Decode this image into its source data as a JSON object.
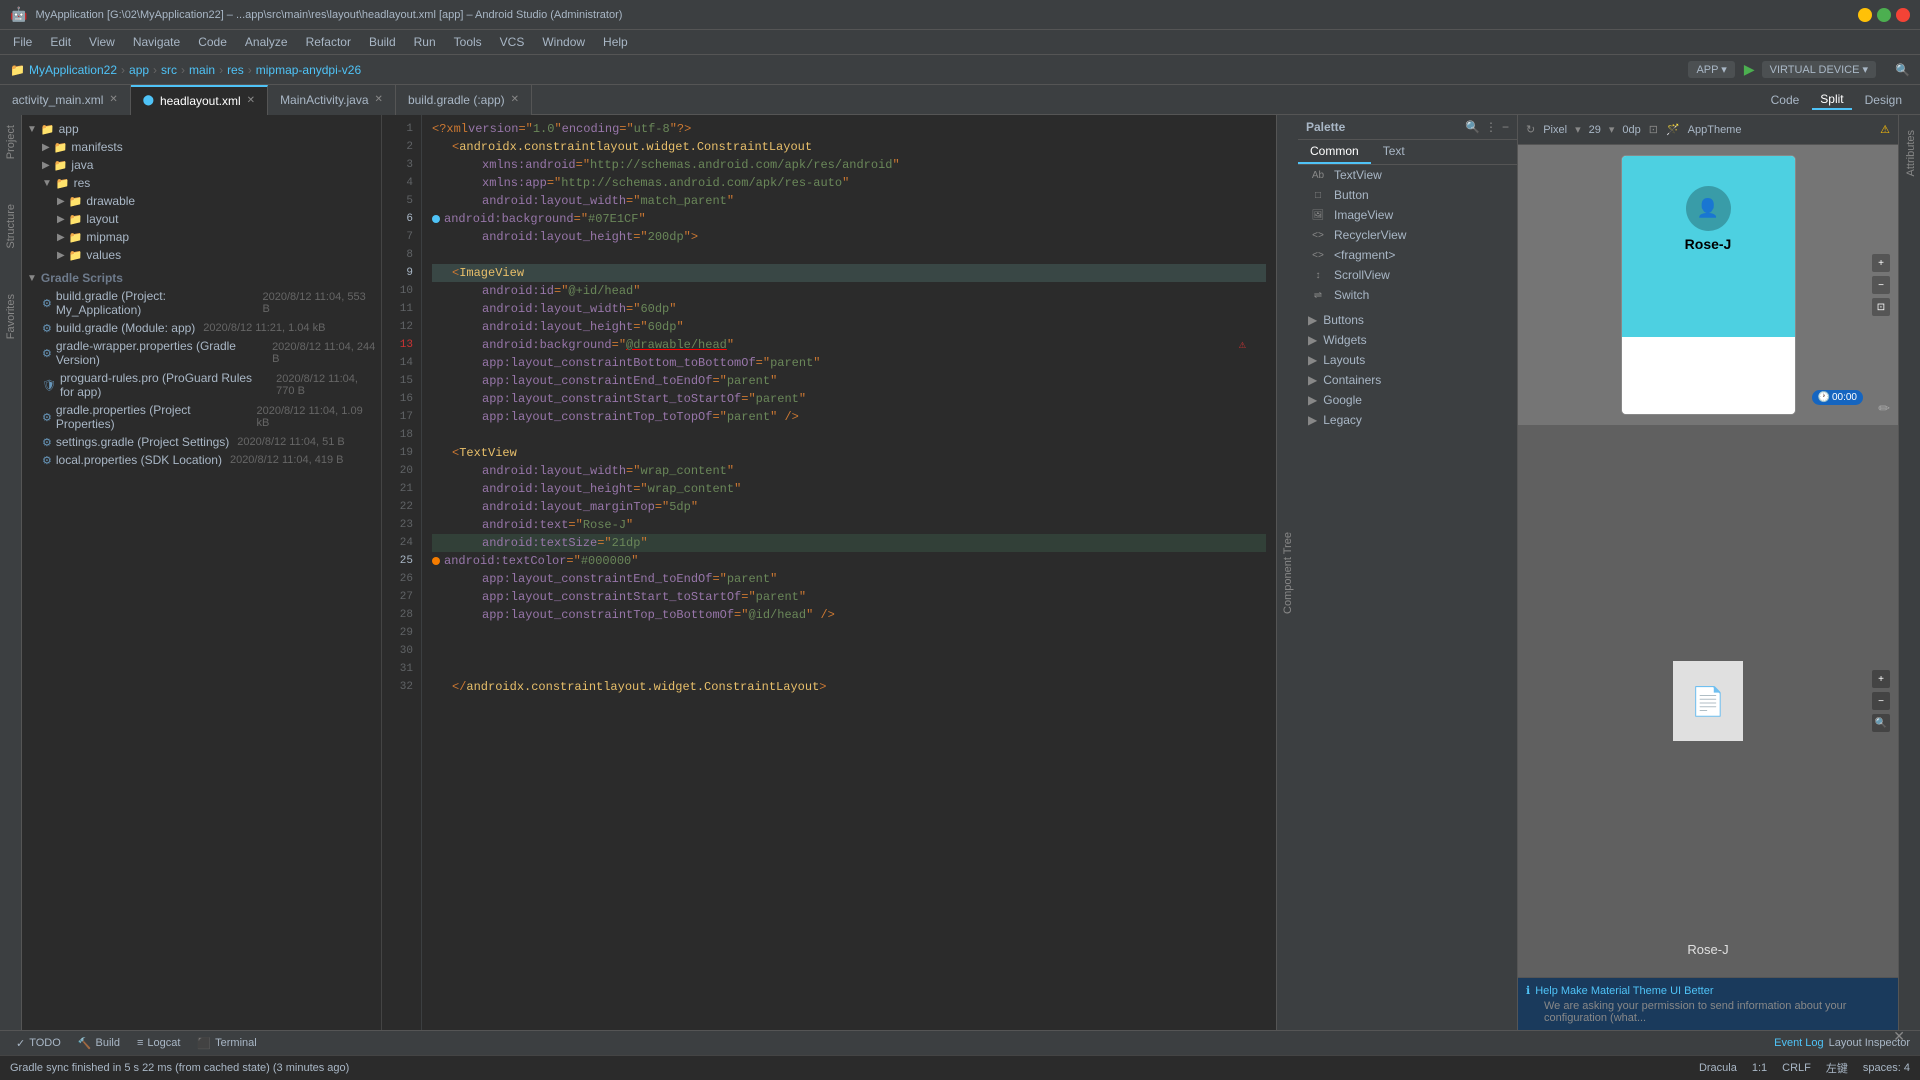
{
  "titlebar": {
    "title": "MyApplication [G:\\02\\MyApplication22] – ...app\\src\\main\\res\\layout\\headlayout.xml [app] – Android Studio (Administrator)",
    "ctrl_min": "–",
    "ctrl_max": "□",
    "ctrl_close": "✕"
  },
  "menubar": {
    "items": [
      "File",
      "Edit",
      "View",
      "Navigate",
      "Code",
      "Analyze",
      "Refactor",
      "Build",
      "Run",
      "Tools",
      "VCS",
      "Window",
      "Help"
    ]
  },
  "breadcrumb": {
    "items": [
      "MyApplication22",
      "app",
      "src",
      "main",
      "res",
      "mipmap-anydpi-v26"
    ],
    "separator": "›"
  },
  "toolbar": {
    "project_label": "APP",
    "device_label": "VIRTUAL DEVICE",
    "run_icon": "▶",
    "debug_icon": "🐞"
  },
  "tabs": [
    {
      "label": "activity_main.xml",
      "active": false
    },
    {
      "label": "headlayout.xml",
      "active": true
    },
    {
      "label": "MainActivity.java",
      "active": false
    },
    {
      "label": "build.gradle (:app)",
      "active": false
    }
  ],
  "file_tree": {
    "root": "app",
    "items": [
      {
        "level": 1,
        "type": "folder",
        "label": "manifests",
        "expanded": true
      },
      {
        "level": 1,
        "type": "folder",
        "label": "java",
        "expanded": true
      },
      {
        "level": 1,
        "type": "folder",
        "label": "res",
        "expanded": true
      },
      {
        "level": 2,
        "type": "folder",
        "label": "drawable",
        "expanded": false
      },
      {
        "level": 2,
        "type": "folder",
        "label": "layout",
        "expanded": false
      },
      {
        "level": 2,
        "type": "folder",
        "label": "mipmap",
        "expanded": false
      },
      {
        "level": 2,
        "type": "folder",
        "label": "values",
        "expanded": false
      },
      {
        "level": 0,
        "type": "section",
        "label": "Gradle Scripts"
      },
      {
        "level": 1,
        "type": "gradle",
        "label": "build.gradle (Project: My_Application)",
        "meta": "2020/8/12 11:04, 553 B"
      },
      {
        "level": 1,
        "type": "gradle",
        "label": "build.gradle (Module: app)",
        "meta": "2020/8/12 11:21, 1.04 kB"
      },
      {
        "level": 1,
        "type": "gradle",
        "label": "gradle-wrapper.properties (Gradle Version)",
        "meta": "2020/8/12 11:04, 244 B"
      },
      {
        "level": 1,
        "type": "gradle",
        "label": "proguard-rules.pro (ProGuard Rules for app)",
        "meta": "2020/8/12 11:04, 770 B"
      },
      {
        "level": 1,
        "type": "gradle",
        "label": "gradle.properties (Project Properties)",
        "meta": "2020/8/12 11:04, 1.09 kB"
      },
      {
        "level": 1,
        "type": "gradle",
        "label": "settings.gradle (Project Settings)",
        "meta": "2020/8/12 11:04, 51 B"
      },
      {
        "level": 1,
        "type": "gradle",
        "label": "local.properties (SDK Location)",
        "meta": "2020/8/12 11:04, 419 B"
      }
    ]
  },
  "code_lines": [
    {
      "num": 1,
      "content": "<?xml version=\"1.0\" encoding=\"utf-8\">",
      "type": "xml"
    },
    {
      "num": 2,
      "content": "    <androidx.constraintlayout.widget.ConstraintLayout",
      "type": "xml"
    },
    {
      "num": 3,
      "content": "        xmlns:android=\"http://schemas.android.com/apk/res/android\"",
      "type": "attr"
    },
    {
      "num": 4,
      "content": "        xmlns:app=\"http://schemas.android.com/apk/res-auto\"",
      "type": "attr"
    },
    {
      "num": 5,
      "content": "        android:layout_width=\"match_parent\"",
      "type": "attr"
    },
    {
      "num": 6,
      "content": "        android:background=\"#07E1CF\"",
      "type": "attr",
      "marker": "blue"
    },
    {
      "num": 7,
      "content": "        android:layout_height=\"200dp\">",
      "type": "attr"
    },
    {
      "num": 8,
      "content": "",
      "type": "empty"
    },
    {
      "num": 9,
      "content": "    <ImageView",
      "type": "xml",
      "highlight": true
    },
    {
      "num": 10,
      "content": "        android:id=\"@+id/head\"",
      "type": "attr"
    },
    {
      "num": 11,
      "content": "        android:layout_width=\"60dp\"",
      "type": "attr"
    },
    {
      "num": 12,
      "content": "        android:layout_height=\"60dp\"",
      "type": "attr"
    },
    {
      "num": 13,
      "content": "        android:background=\"@drawable/head\"",
      "type": "attr",
      "error": true
    },
    {
      "num": 14,
      "content": "        app:layout_constraintBottom_toBottomOf=\"parent\"",
      "type": "attr"
    },
    {
      "num": 15,
      "content": "        app:layout_constraintEnd_toEndOf=\"parent\"",
      "type": "attr"
    },
    {
      "num": 16,
      "content": "        app:layout_constraintStart_toStartOf=\"parent\"",
      "type": "attr"
    },
    {
      "num": 17,
      "content": "        app:layout_constraintTop_toTopOf=\"parent\" />",
      "type": "attr"
    },
    {
      "num": 18,
      "content": "",
      "type": "empty"
    },
    {
      "num": 19,
      "content": "    <TextView",
      "type": "xml"
    },
    {
      "num": 20,
      "content": "        android:layout_width=\"wrap_content\"",
      "type": "attr"
    },
    {
      "num": 21,
      "content": "        android:layout_height=\"wrap_content\"",
      "type": "attr"
    },
    {
      "num": 22,
      "content": "        android:layout_marginTop=\"5dp\"",
      "type": "attr"
    },
    {
      "num": 23,
      "content": "        android:text=\"Rose-J\"",
      "type": "attr"
    },
    {
      "num": 24,
      "content": "        android:textSize=\"21dp\"",
      "type": "attr",
      "highlight_text": true
    },
    {
      "num": 25,
      "content": "        android:textColor=\"#000000\"",
      "type": "attr",
      "marker": "orange"
    },
    {
      "num": 26,
      "content": "        app:layout_constraintEnd_toEndOf=\"parent\"",
      "type": "attr"
    },
    {
      "num": 27,
      "content": "        app:layout_constraintStart_toStartOf=\"parent\"",
      "type": "attr"
    },
    {
      "num": 28,
      "content": "        app:layout_constraintTop_toBottomOf=\"@id/head\" />",
      "type": "attr"
    },
    {
      "num": 29,
      "content": "",
      "type": "empty"
    },
    {
      "num": 30,
      "content": "",
      "type": "empty"
    },
    {
      "num": 31,
      "content": "",
      "type": "empty"
    },
    {
      "num": 32,
      "content": "    </androidx.constraintlayout.widget.ConstraintLayout>",
      "type": "xml"
    }
  ],
  "palette": {
    "title": "Palette",
    "tabs": [
      "Common",
      "Text"
    ],
    "active_tab": "Common",
    "sections": {
      "common_items": [
        {
          "icon": "Ab",
          "label": "TextView"
        },
        {
          "icon": "□",
          "label": "Button"
        },
        {
          "icon": "🖼",
          "label": "ImageView"
        },
        {
          "icon": "<>",
          "label": "RecyclerView"
        },
        {
          "icon": "<>",
          "label": "<fragment>"
        },
        {
          "icon": "↕",
          "label": "ScrollView"
        },
        {
          "icon": "⇌",
          "label": "Switch"
        }
      ],
      "category_items": [
        "Buttons",
        "Widgets",
        "Layouts",
        "Containers",
        "Google",
        "Legacy"
      ]
    }
  },
  "preview": {
    "toolbar": {
      "pixel_label": "Pixel",
      "dp_label": "29",
      "zoom_label": "0dp",
      "theme_label": "AppTheme"
    },
    "design_tabs": [
      "Code",
      "Split",
      "Design"
    ],
    "active_tab": "Split",
    "preview_name": "Rose-J",
    "file_name": "Rose-J"
  },
  "status_bar": {
    "gradle_message": "Gradle sync finished in 5 s 22 ms (from cached state) (3 minutes ago)",
    "event_log": "Event Log",
    "layout_inspector": "Layout Inspector",
    "encoding": "Dracula",
    "line_sep": "1:1",
    "line_ending": "CRLF",
    "chinese_label": "左键",
    "spaces": "spaces",
    "indent": "4"
  },
  "bottom_tabs": [
    {
      "icon": "✓",
      "label": "TODO"
    },
    {
      "icon": "🔨",
      "label": "Build"
    },
    {
      "icon": "≡",
      "label": "Logcat"
    },
    {
      "icon": "⬛",
      "label": "Terminal"
    }
  ],
  "info_banner": {
    "icon": "ℹ",
    "text": "Help Make Material Theme UI Better",
    "description": "We are asking your permission to send information about your configuration (what..."
  },
  "component_tree": {
    "label": "Component Tree"
  },
  "timer": {
    "value": "00:00"
  }
}
